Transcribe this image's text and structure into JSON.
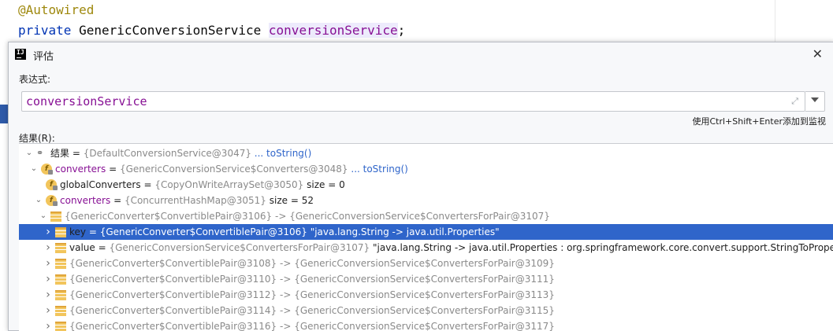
{
  "editor": {
    "annotation": "@Autowired",
    "line2_keyword": "private",
    "line2_type": "GenericConversionService",
    "line2_field": "conversionService",
    "line2_end": ";"
  },
  "dialog": {
    "title": "评估",
    "close": "✕",
    "expression_label": "表达式:",
    "expression_value": "conversionService",
    "hint": "使用Ctrl+Shift+Enter添加到监视",
    "result_label": "结果(R):"
  },
  "tree": [
    {
      "name": "结果",
      "eq": " = ",
      "value": "{DefaultConversionService@3047}",
      "extra": " ... toString()",
      "icon": "watch-icon",
      "expanded": true
    },
    {
      "name": "converters",
      "eq": " = ",
      "value": "{GenericConversionService$Converters@3048}",
      "extra": " ... toString()",
      "icon": "field-icon",
      "expanded": true
    },
    {
      "name": "globalConverters",
      "eq": " = ",
      "value": "{CopyOnWriteArraySet@3050}",
      "extra": "  size = 0",
      "icon": "field-icon",
      "expanded": false
    },
    {
      "name": "converters",
      "eq": " = ",
      "value": "{ConcurrentHashMap@3051}",
      "extra": "  size = 52",
      "icon": "field-icon",
      "expanded": true
    },
    {
      "name": "",
      "eq": "",
      "value": "{GenericConverter$ConvertiblePair@3106}",
      "extra": "  -> {GenericConversionService$ConvertersForPair@3107}",
      "icon": "list-icon",
      "expanded": true
    },
    {
      "name": "key",
      "eq": " = ",
      "value": "{GenericConverter$ConvertiblePair@3106}",
      "extra": " \"java.lang.String -> java.util.Properties\"",
      "icon": "list-icon",
      "expanded": false
    },
    {
      "name": "value",
      "eq": " = ",
      "value": "{GenericConversionService$ConvertersForPair@3107}",
      "extra": " \"java.lang.String -> java.util.Properties : org.springframework.core.convert.support.StringToPropertiesC",
      "icon": "list-icon",
      "expanded": false
    },
    {
      "name": "",
      "eq": "",
      "value": "{GenericConverter$ConvertiblePair@3108}",
      "extra": "  -> {GenericConversionService$ConvertersForPair@3109}",
      "icon": "list-icon",
      "expanded": false
    },
    {
      "name": "",
      "eq": "",
      "value": "{GenericConverter$ConvertiblePair@3110}",
      "extra": "  -> {GenericConversionService$ConvertersForPair@3111}",
      "icon": "list-icon",
      "expanded": false
    },
    {
      "name": "",
      "eq": "",
      "value": "{GenericConverter$ConvertiblePair@3112}",
      "extra": "  -> {GenericConversionService$ConvertersForPair@3113}",
      "icon": "list-icon",
      "expanded": false
    },
    {
      "name": "",
      "eq": "",
      "value": "{GenericConverter$ConvertiblePair@3114}",
      "extra": "  -> {GenericConversionService$ConvertersForPair@3115}",
      "icon": "list-icon",
      "expanded": false
    },
    {
      "name": "",
      "eq": "",
      "value": "{GenericConverter$ConvertiblePair@3116}",
      "extra": "  -> {GenericConversionService$ConvertersForPair@3117}",
      "icon": "list-icon",
      "expanded": false
    }
  ]
}
